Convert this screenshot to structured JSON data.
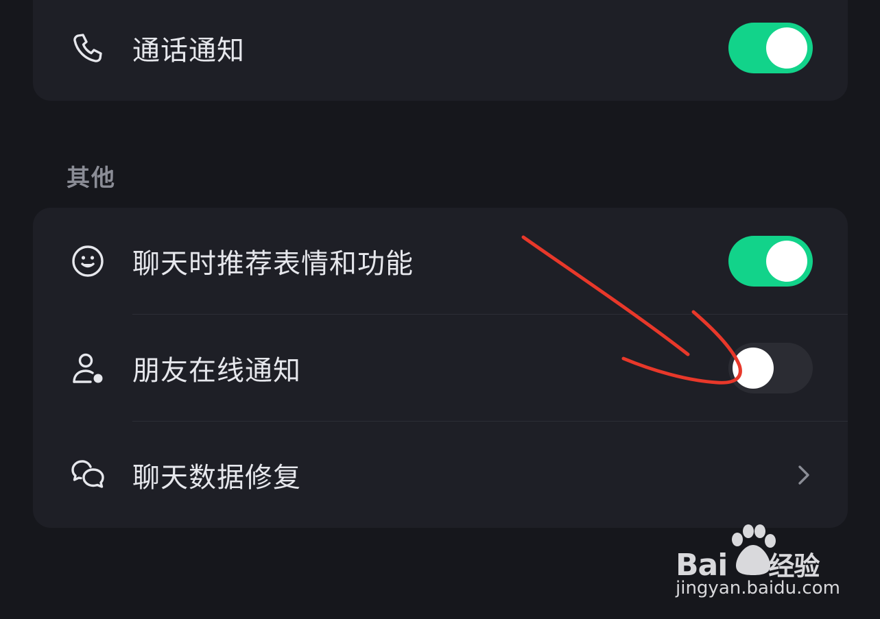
{
  "colors": {
    "background": "#16171c",
    "card": "#1e1f26",
    "toggle_on": "#12d38a",
    "toggle_off": "#2b2c33",
    "annotation": "#e8382a"
  },
  "top_section": {
    "rows": [
      {
        "label": "通话通知",
        "icon": "phone-icon",
        "control": "toggle",
        "on": true
      }
    ]
  },
  "other_section": {
    "title": "其他",
    "rows": [
      {
        "label": "聊天时推荐表情和功能",
        "icon": "smiley-icon",
        "control": "toggle",
        "on": true
      },
      {
        "label": "朋友在线通知",
        "icon": "user-online-icon",
        "control": "toggle",
        "on": false
      },
      {
        "label": "聊天数据修复",
        "icon": "chat-bubbles-icon",
        "control": "chevron"
      }
    ]
  },
  "watermark": {
    "brand": "Bai",
    "brand_du": "du",
    "brand_cn": "经验",
    "url": "jingyan.baidu.com"
  }
}
